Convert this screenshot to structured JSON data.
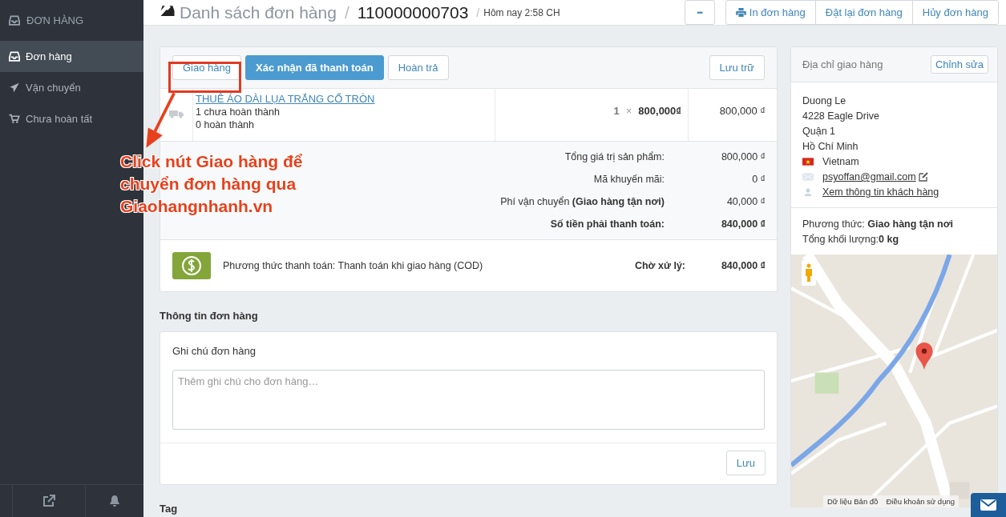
{
  "sidebar": {
    "title": "ĐƠN HÀNG",
    "items": [
      {
        "label": "Đơn hàng",
        "selected": true
      },
      {
        "label": "Vận chuyển",
        "selected": false
      },
      {
        "label": "Chưa hoàn tất",
        "selected": false
      }
    ]
  },
  "header": {
    "section": "Danh sách đơn hàng",
    "separator": "/",
    "order_number": "110000000703",
    "time": "Hôm nay 2:58 CH",
    "more": "•••",
    "actions": [
      "In đơn hàng",
      "Đặt lại đơn hàng",
      "Hủy đơn hàng"
    ]
  },
  "fulfillment": {
    "buttons": [
      {
        "label": "Giao hàng",
        "primary": false
      },
      {
        "label": "Xác nhận đã thanh toán",
        "primary": true
      },
      {
        "label": "Hoàn trả",
        "primary": false
      }
    ],
    "archive": "Lưu trữ",
    "item": {
      "name": "THUÊ ÁO DÀI LỤA TRẮNG CỔ TRÒN",
      "unfulfilled": "1 chưa hoàn thành",
      "fulfilled": "0 hoàn thành",
      "quantity": "1",
      "times": "×",
      "price": "800,000₫",
      "total": "800,000 ₫"
    },
    "totals": [
      {
        "label": "Tổng giá trị sản phẩm:",
        "value": "800,000 ₫",
        "bold": false
      },
      {
        "label": "Mã khuyến mãi:",
        "value": "0 ₫",
        "bold": false
      },
      {
        "label": "Phí vận chuyển **(Giao hàng tận nơi)**",
        "value": "40,000 ₫",
        "bold": false
      },
      {
        "label": "Số tiền phải thanh toán:",
        "value": "840,000 ₫",
        "bold": true
      }
    ],
    "payment": {
      "method": "Phương thức thanh toán: Thanh toán khi giao hàng (COD)",
      "status": "Chờ xử lý:",
      "amount": "840,000 ₫"
    }
  },
  "order_info": {
    "title": "Thông tin đơn hàng",
    "note_label": "Ghi chú đơn hàng",
    "placeholder": "Thêm ghi chú cho đơn hàng…",
    "save": "Lưu"
  },
  "tag_title": "Tag",
  "shipping": {
    "title": "Địa chỉ giao hàng",
    "edit": "Chỉnh sửa",
    "name": "Duong Le",
    "address": "4228 Eagle Drive",
    "district": "Quận 1",
    "city": "Hồ Chí Minh",
    "country": "Vietnam",
    "email": "psyoffan@gmail.com",
    "customer_link": "Xem thông tin khách hàng",
    "method": "Phương thức: **Giao hàng tận nơi**",
    "weight": "Tổng khối lượng:**0 kg**",
    "map": {
      "kind": "picture",
      "links": [
        "Dữ liệu Bản đồ",
        "Điều khoản sử dụng"
      ]
    }
  },
  "annotation": {
    "lines": [
      "Click nút Giao hàng để",
      "chuyển đơn hàng qua",
      "Giaohangnhanh.vn"
    ]
  }
}
